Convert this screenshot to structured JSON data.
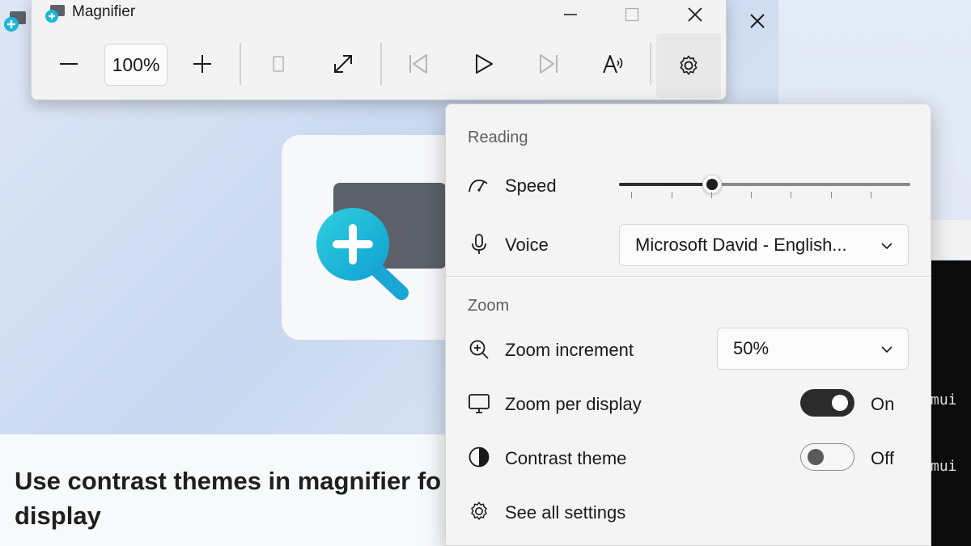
{
  "magnifier": {
    "title": "Magnifier",
    "zoom_level": "100%",
    "buttons": [
      "zoom-out",
      "zoom-in",
      "view-mode",
      "resize",
      "previous",
      "play",
      "next",
      "read-from-here",
      "settings"
    ]
  },
  "background": {
    "tip_title": "Use contrast themes in magnifier fo display",
    "terminal_lines": [
      "mui",
      "mui"
    ]
  },
  "flyout": {
    "reading": {
      "section_title": "Reading",
      "speed_label": "Speed",
      "speed_value_fraction": 0.32,
      "voice_label": "Voice",
      "voice_value": "Microsoft David - English..."
    },
    "zoom": {
      "section_title": "Zoom",
      "increment_label": "Zoom increment",
      "increment_value": "50%",
      "per_display_label": "Zoom per display",
      "per_display_state": "On",
      "contrast_label": "Contrast theme",
      "contrast_state": "Off",
      "see_all_label": "See all settings"
    }
  },
  "colors": {
    "accent_dark": "#2b2b2b",
    "lens_cyan": "#1cb6d6",
    "terminal_bg": "#0c0c0c"
  }
}
